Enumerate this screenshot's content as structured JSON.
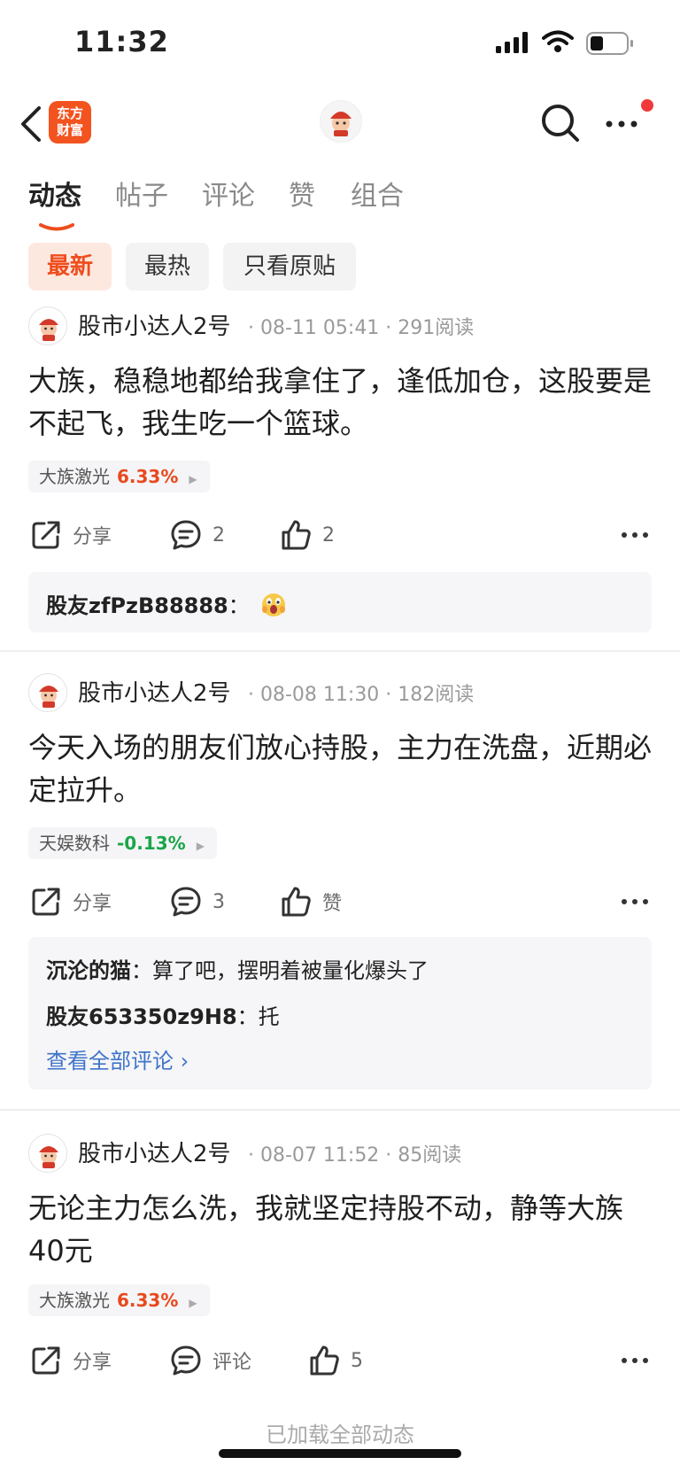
{
  "status_bar": {
    "time": "11:32"
  },
  "nav": {
    "logo_text_line1": "东方",
    "logo_text_line2": "财富"
  },
  "tabs": [
    {
      "label": "动态",
      "active": true
    },
    {
      "label": "帖子",
      "active": false
    },
    {
      "label": "评论",
      "active": false
    },
    {
      "label": "赞",
      "active": false
    },
    {
      "label": "组合",
      "active": false
    }
  ],
  "filters": [
    {
      "label": "最新",
      "active": true
    },
    {
      "label": "最热",
      "active": false
    },
    {
      "label": "只看原贴",
      "active": false
    }
  ],
  "colors": {
    "accent": "#ee4d1d",
    "up": "#e8491d",
    "down": "#1aa64a",
    "link": "#3f74c9"
  },
  "posts": [
    {
      "author": "股市小达人2号",
      "meta": "· 08-11 05:41 · 291阅读",
      "text": "大族，稳稳地都给我拿住了，逢低加仓，这股要是不起飞，我生吃一个篮球。",
      "stock": {
        "name": "大族激光",
        "change": "6.33%",
        "direction": "up"
      },
      "share_label": "分享",
      "comment_label": "2",
      "like_label": "2",
      "comments": [
        {
          "user": "股友zfPzB88888",
          "sep": "：",
          "text": "",
          "emoji": "scared-face-emoji"
        }
      ]
    },
    {
      "author": "股市小达人2号",
      "meta": "· 08-08 11:30 · 182阅读",
      "text": "今天入场的朋友们放心持股，主力在洗盘，近期必定拉升。",
      "stock": {
        "name": "天娱数科",
        "change": "-0.13%",
        "direction": "down"
      },
      "share_label": "分享",
      "comment_label": "3",
      "like_label": "赞",
      "comments": [
        {
          "user": "沉沦的猫",
          "sep": "：",
          "text": "算了吧，摆明着被量化爆头了"
        },
        {
          "user": "股友653350z9H8",
          "sep": "：",
          "text": "托"
        }
      ],
      "view_all": "查看全部评论 ›"
    },
    {
      "author": "股市小达人2号",
      "meta": "· 08-07 11:52 · 85阅读",
      "text": "无论主力怎么洗，我就坚定持股不动，静等大族40元",
      "stock": {
        "name": "大族激光",
        "change": "6.33%",
        "direction": "up"
      },
      "share_label": "分享",
      "comment_label": "评论",
      "like_label": "5"
    }
  ],
  "footer": "已加载全部动态"
}
